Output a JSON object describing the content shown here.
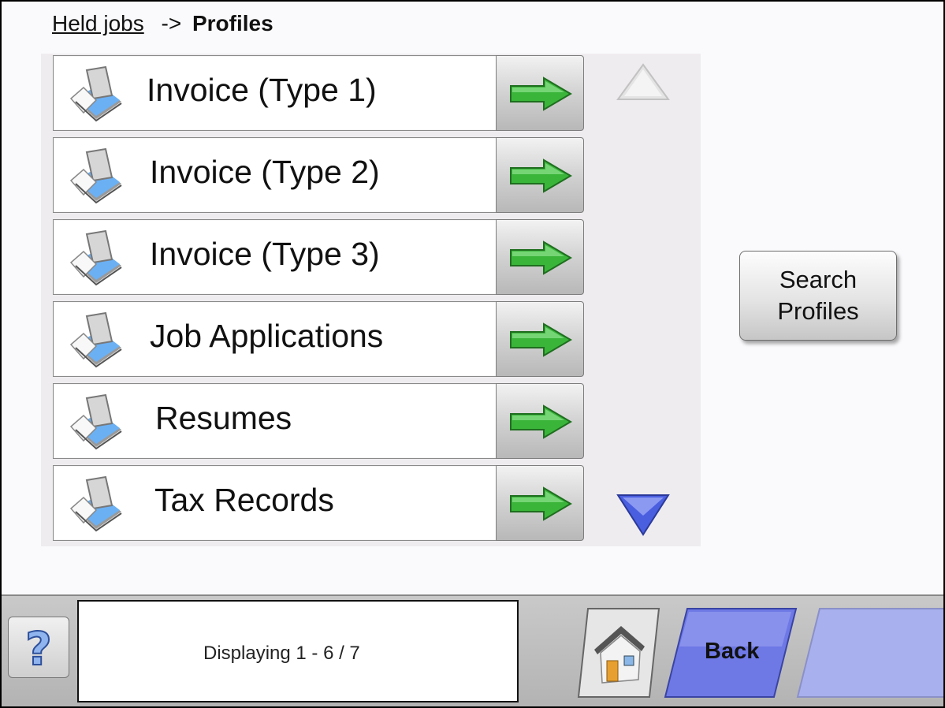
{
  "breadcrumb": {
    "parent": "Held jobs",
    "separator": "->",
    "current": "Profiles"
  },
  "profiles": [
    {
      "label": "Invoice (Type 1)"
    },
    {
      "label": "Invoice (Type 2)"
    },
    {
      "label": "Invoice (Type 3)"
    },
    {
      "label": "Job Applications"
    },
    {
      "label": "Resumes"
    },
    {
      "label": "Tax Records"
    }
  ],
  "search_button": {
    "label": "Search\nProfiles"
  },
  "status": {
    "text": "Displaying 1 - 6 / 7"
  },
  "nav": {
    "back_label": "Back",
    "help_icon": "question-mark-icon",
    "home_icon": "house-icon"
  },
  "colors": {
    "arrow_green": "#3ab53a",
    "scroll_blue": "#4a5ee0",
    "back_blue": "#6e79e6"
  }
}
